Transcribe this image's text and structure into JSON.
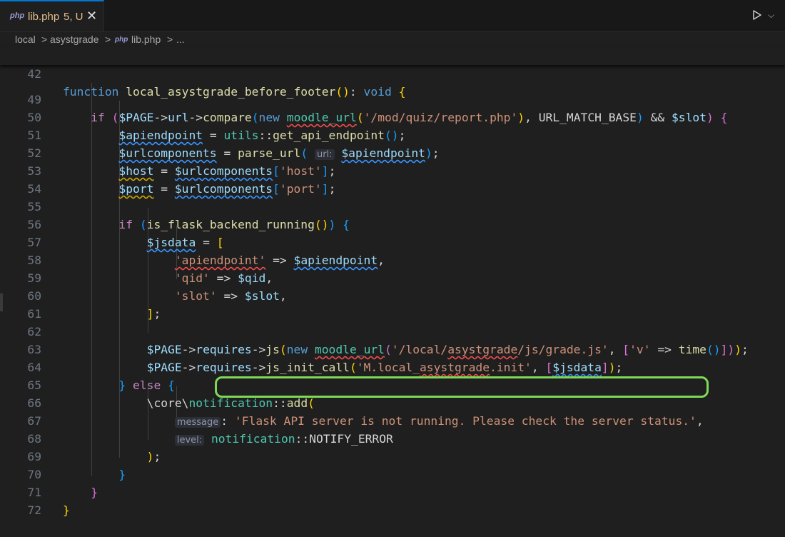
{
  "tab": {
    "icon": "php",
    "filename": "lib.php",
    "status": "5, U",
    "close": "✕"
  },
  "toolbar": {
    "run_icon": "run-icon",
    "run_chevron": "⌵"
  },
  "breadcrumb": {
    "items": [
      "local",
      ">",
      "asystgrade",
      ">",
      "php",
      "lib.php",
      ">",
      "..."
    ]
  },
  "editor": {
    "sticky_line": "42",
    "line_numbers": [
      "49",
      "50",
      "51",
      "52",
      "53",
      "54",
      "55",
      "56",
      "57",
      "58",
      "59",
      "60",
      "61",
      "62",
      "63",
      "64",
      "65",
      "66",
      "67",
      "68",
      "69",
      "70",
      "71",
      "72"
    ],
    "hints": {
      "url": "url:",
      "message": "message",
      "level": "level:"
    }
  },
  "colors": {
    "highlight_box": "#7ed957",
    "tab_accent": "#0078d4"
  }
}
